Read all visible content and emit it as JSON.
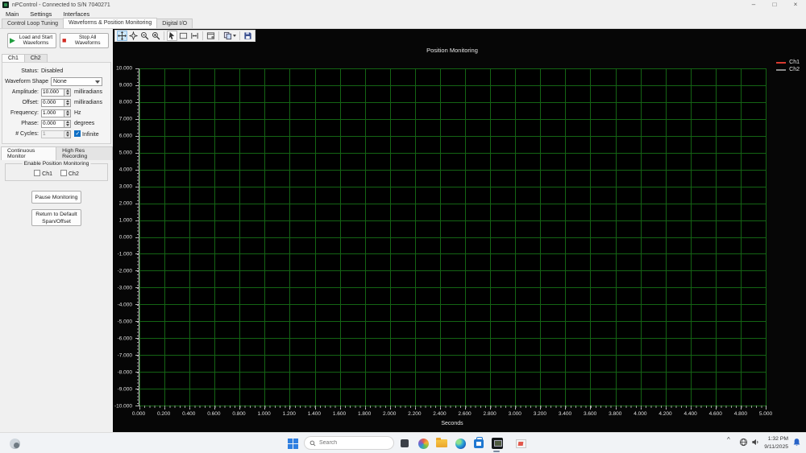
{
  "window": {
    "title": "nPControl - Connected to S/N 7040271",
    "controls": {
      "minimize": "–",
      "maximize": "□",
      "close": "×"
    }
  },
  "menubar": {
    "items": [
      {
        "label": "Main"
      },
      {
        "label": "Settings"
      },
      {
        "label": "Interfaces"
      }
    ]
  },
  "main_tabs": {
    "active_index": 1,
    "items": [
      {
        "label": "Control Loop Tuning"
      },
      {
        "label": "Waveforms & Position Monitoring"
      },
      {
        "label": "Digital I/O"
      }
    ]
  },
  "waveform_panel": {
    "load_start_button": "Load and Start Waveforms",
    "stop_all_button": "Stop All Waveforms",
    "channel_tabs": {
      "active_index": 0,
      "items": [
        {
          "label": "Ch1"
        },
        {
          "label": "Ch2"
        }
      ]
    },
    "status": {
      "label": "Status:",
      "value": "Disabled"
    },
    "waveform_shape": {
      "label": "Waveform Shape",
      "value": "None"
    },
    "amplitude": {
      "label": "Amplitude:",
      "value": "10.000",
      "unit": "milliradians"
    },
    "offset": {
      "label": "Offset:",
      "value": "0.000",
      "unit": "milliradians"
    },
    "frequency": {
      "label": "Frequency:",
      "value": "1.000",
      "unit": "Hz"
    },
    "phase": {
      "label": "Phase:",
      "value": "0.000",
      "unit": "degrees"
    },
    "cycles": {
      "label": "# Cycles:",
      "value": "1",
      "infinite_label": "Infinite",
      "infinite_checked": true
    }
  },
  "monitor_panel": {
    "tabs": {
      "active_index": 0,
      "items": [
        {
          "label": "Continuous Monitor"
        },
        {
          "label": "High Res Recording"
        }
      ]
    },
    "enable_group": {
      "title": "Enable Position Monitoring",
      "ch1_label": "Ch1",
      "ch2_label": "Ch2",
      "ch1_checked": false,
      "ch2_checked": false
    },
    "pause_button": "Pause Monitoring",
    "return_button": "Return to Default Span/Offset"
  },
  "plot_toolbar": {
    "icons": [
      {
        "name": "pan-icon",
        "selected": true
      },
      {
        "name": "zoom-select-icon"
      },
      {
        "name": "zoom-out-icon"
      },
      {
        "name": "zoom-in-icon"
      },
      {
        "name": "cursor-icon",
        "framed": true
      },
      {
        "name": "box-zoom-icon"
      },
      {
        "name": "cursor-pair-icon"
      },
      {
        "name": "plot-settings-icon"
      },
      {
        "name": "copy-plot-icon"
      },
      {
        "name": "save-plot-icon"
      }
    ]
  },
  "chart_data": {
    "type": "line",
    "title": "Position Monitoring",
    "xlabel": "Seconds",
    "ylabel": "",
    "xlim": [
      0.0,
      5.0
    ],
    "ylim": [
      -10.0,
      10.0
    ],
    "grid": true,
    "background": "#000000",
    "grid_color": "#146414",
    "axis_color": "#c0c0c0",
    "text_color": "#e0e0e0",
    "legend_position": "top-right",
    "x_tick_labels": [
      "0.000",
      "0.200",
      "0.400",
      "0.600",
      "0.800",
      "1.000",
      "1.200",
      "1.400",
      "1.600",
      "1.800",
      "2.000",
      "2.200",
      "2.400",
      "2.600",
      "2.800",
      "3.000",
      "3.200",
      "3.400",
      "3.600",
      "3.800",
      "4.000",
      "4.200",
      "4.400",
      "4.600",
      "4.800",
      "5.000"
    ],
    "y_tick_labels": [
      "10.000",
      "9.000",
      "8.000",
      "7.000",
      "6.000",
      "5.000",
      "4.000",
      "3.000",
      "2.000",
      "1.000",
      "0.000",
      "-1.000",
      "-2.000",
      "-3.000",
      "-4.000",
      "-5.000",
      "-6.000",
      "-7.000",
      "-8.000",
      "-9.000",
      "-10.000"
    ],
    "series": [
      {
        "name": "Ch1",
        "color": "#d93a30",
        "values": []
      },
      {
        "name": "Ch2",
        "color": "#8a8a8a",
        "values": []
      }
    ]
  },
  "taskbar": {
    "search_placeholder": "Search",
    "icons": [
      "weather-icon",
      "start-button",
      "search-box",
      "task-view-icon",
      "copilot-icon",
      "file-explorer-icon",
      "edge-icon",
      "store-icon",
      "npcontrol-app-icon",
      "remote-viewer-icon"
    ],
    "tray": {
      "chevron": "^",
      "time": "1:32 PM",
      "date": "9/11/2025"
    }
  }
}
